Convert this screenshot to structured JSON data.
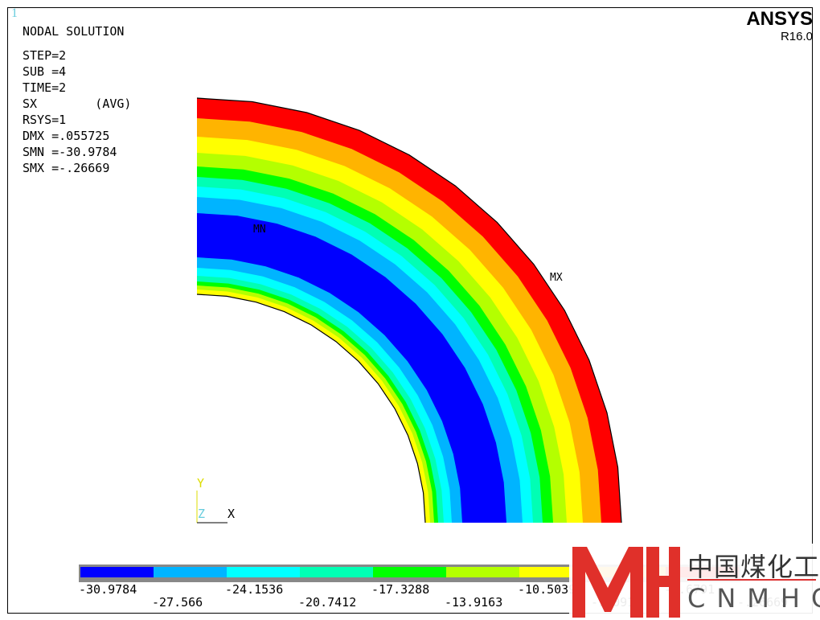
{
  "window_number": "1",
  "brand": {
    "name": "ANSYS",
    "release": "R16.0"
  },
  "info": {
    "title": "NODAL SOLUTION",
    "lines": [
      "STEP=2",
      "SUB =4",
      "TIME=2",
      "SX        (AVG)",
      "RSYS=1",
      "DMX =.055725",
      "SMN =-30.9784",
      "SMX =-.26669"
    ]
  },
  "markers": {
    "min": "MN",
    "max": "MX"
  },
  "triad": {
    "y": "Y",
    "z": "Z",
    "x": "X"
  },
  "legend": {
    "values": [
      "-30.9784",
      "-27.566",
      "-24.1536",
      "-20.7412",
      "-17.3288",
      "-13.9163",
      "-10.5039",
      "-7.0915",
      "-3.6791",
      "-.26669"
    ],
    "colors": [
      "#0000ff",
      "#00b4ff",
      "#00ffff",
      "#00ffb4",
      "#00ff00",
      "#b4ff00",
      "#ffff00",
      "#ffb400",
      "#ff0000"
    ]
  },
  "watermark": {
    "cn": "中国煤化工",
    "en": "CNMHG",
    "color": "#e0302a"
  }
}
